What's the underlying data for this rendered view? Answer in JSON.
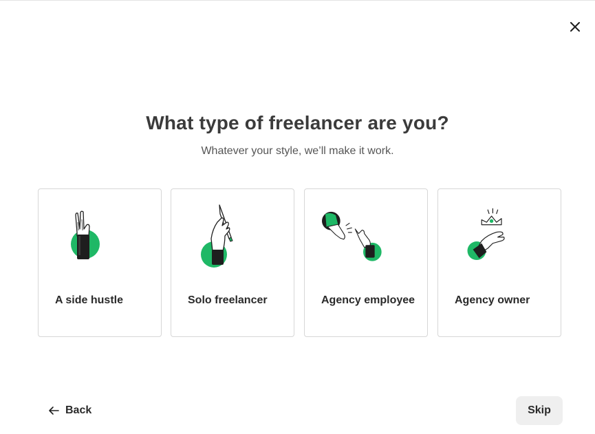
{
  "header": {
    "close_icon": "close-icon"
  },
  "heading": {
    "title": "What type of freelancer are you?",
    "subtitle": "Whatever your style, we’ll make it work."
  },
  "options": [
    {
      "label": "A side hustle",
      "icon": "peace-sign-hand-icon"
    },
    {
      "label": "Solo freelancer",
      "icon": "hand-holding-pencil-icon"
    },
    {
      "label": "Agency employee",
      "icon": "hands-snapping-icon"
    },
    {
      "label": "Agency owner",
      "icon": "hand-holding-crown-icon"
    }
  ],
  "footer": {
    "back_label": "Back",
    "skip_label": "Skip"
  },
  "colors": {
    "accent_green": "#1fb866",
    "sleeve_dark": "#1e1e1e",
    "title_text": "#3b3b3b",
    "card_border": "#d6d6d6",
    "skip_bg": "#efefef"
  }
}
